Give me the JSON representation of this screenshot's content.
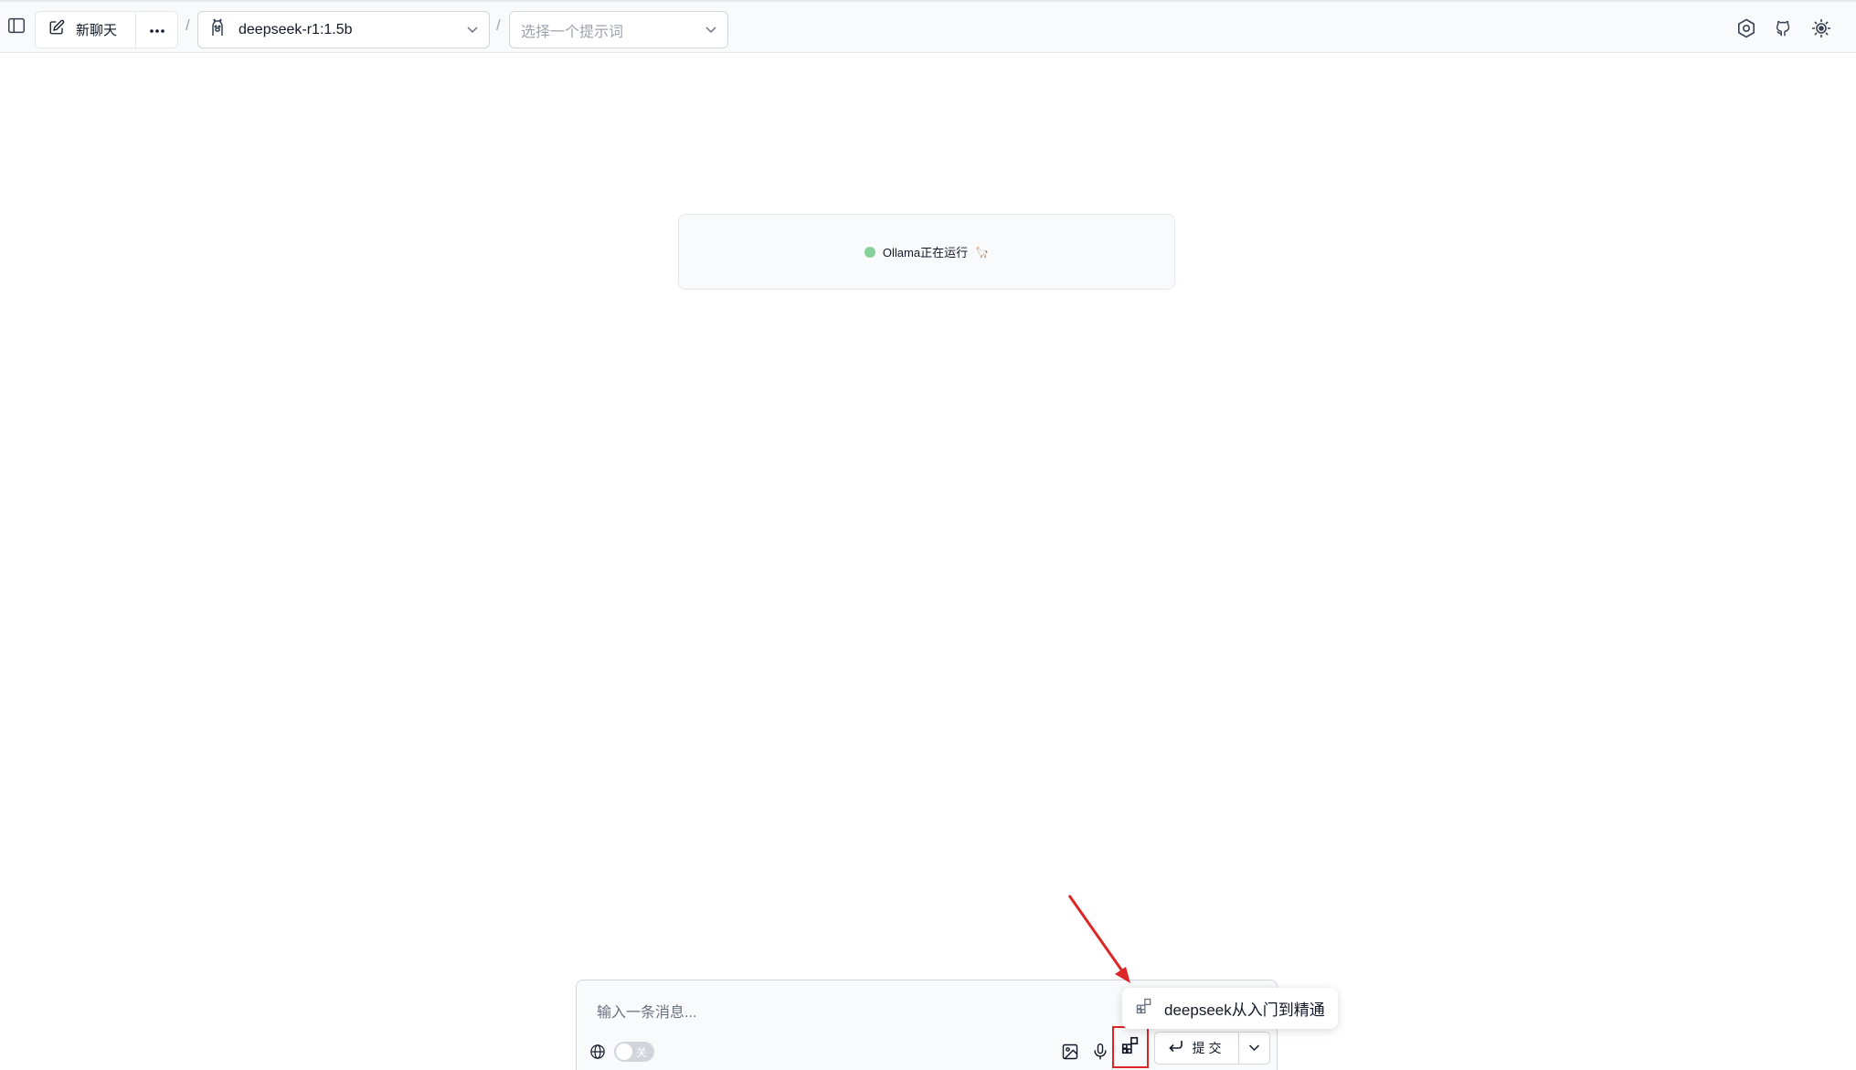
{
  "header": {
    "new_chat_label": "新聊天",
    "model_select": {
      "value": "deepseek-r1:1.5b"
    },
    "prompt_select": {
      "placeholder": "选择一个提示词"
    },
    "separator": "/"
  },
  "status": {
    "text": "Ollama正在运行",
    "emoji": "🦙",
    "dot_color": "#86d19c"
  },
  "composer": {
    "placeholder": "输入一条消息...",
    "web_search_toggle": {
      "label": "关",
      "state": "off"
    },
    "submit_label": "提交"
  },
  "plugin_popup": {
    "item_label": "deepseek从入门到精通"
  },
  "colors": {
    "annotation": "#dc2626",
    "toolbar_bg": "#f9fafb"
  },
  "icons": [
    "sidebar-toggle-icon",
    "edit-icon",
    "more-icon",
    "llama-icon",
    "chevron-down-icon",
    "settings-icon",
    "github-icon",
    "theme-icon",
    "globe-icon",
    "image-icon",
    "microphone-icon",
    "plugin-icon",
    "enter-icon"
  ]
}
